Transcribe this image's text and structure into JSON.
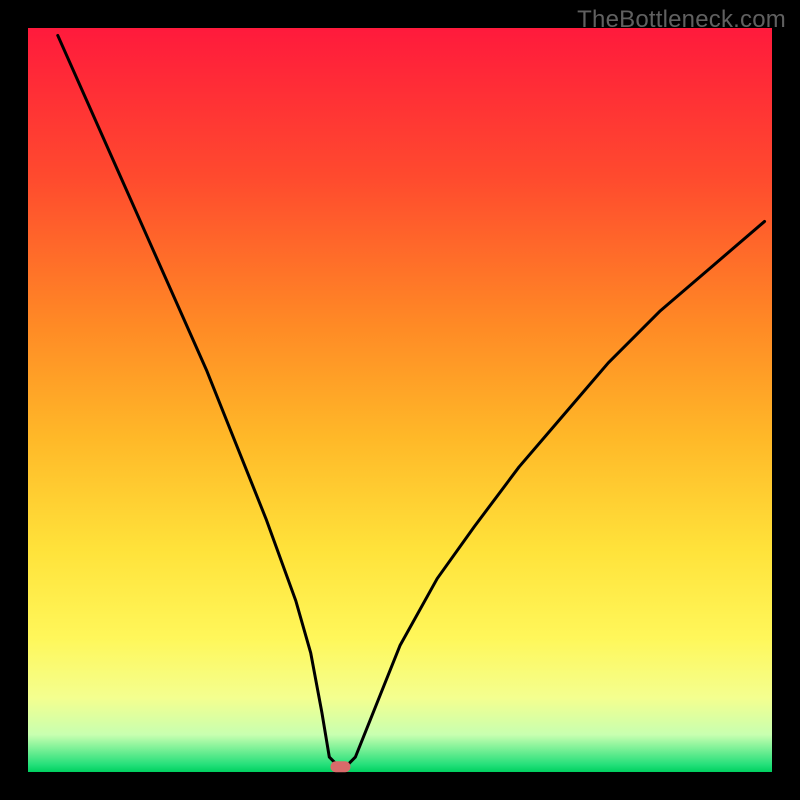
{
  "watermark": "TheBottleneck.com",
  "chart_data": {
    "type": "line",
    "title": "",
    "xlabel": "",
    "ylabel": "",
    "xlim": [
      0,
      100
    ],
    "ylim": [
      0,
      100
    ],
    "series": [
      {
        "name": "bottleneck-curve",
        "x": [
          4,
          8,
          12,
          16,
          20,
          24,
          28,
          32,
          36,
          38,
          39.5,
          40.5,
          41.5,
          43,
          44,
          46,
          50,
          55,
          60,
          66,
          72,
          78,
          85,
          92,
          99
        ],
        "values": [
          99,
          90,
          81,
          72,
          63,
          54,
          44,
          34,
          23,
          16,
          8,
          2,
          1,
          1,
          2,
          7,
          17,
          26,
          33,
          41,
          48,
          55,
          62,
          68,
          74
        ]
      }
    ],
    "marker": {
      "x": 42,
      "y": 0.7,
      "color": "#d96a6a"
    },
    "gradient_stops": [
      {
        "offset": 0,
        "color": "#ff1a3c"
      },
      {
        "offset": 20,
        "color": "#ff4a2e"
      },
      {
        "offset": 40,
        "color": "#ff8a25"
      },
      {
        "offset": 55,
        "color": "#ffb828"
      },
      {
        "offset": 70,
        "color": "#ffe23a"
      },
      {
        "offset": 82,
        "color": "#fff75a"
      },
      {
        "offset": 90,
        "color": "#f4ff8f"
      },
      {
        "offset": 95,
        "color": "#c8ffb0"
      },
      {
        "offset": 99,
        "color": "#25e07a"
      },
      {
        "offset": 100,
        "color": "#00d060"
      }
    ],
    "frame_color": "#000000",
    "frame_thickness_ratio": 0.035
  }
}
